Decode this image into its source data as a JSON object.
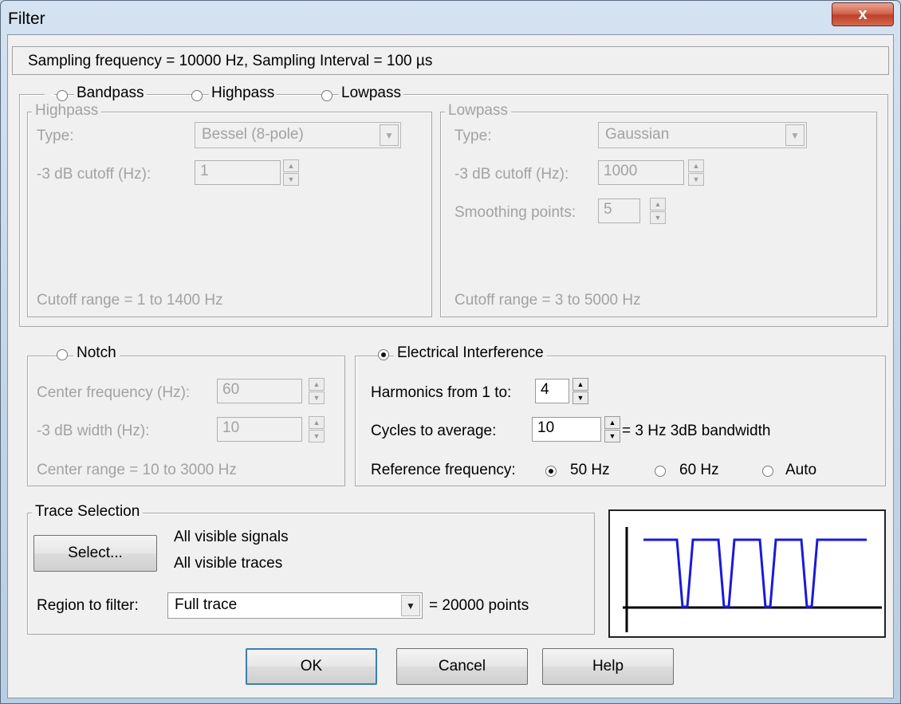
{
  "window": {
    "title": "Filter",
    "close_glyph": "x"
  },
  "info": "Sampling frequency = 10000 Hz, Sampling Interval = 100 µs",
  "filter_modes": {
    "bandpass": "Bandpass",
    "highpass": "Highpass",
    "lowpass": "Lowpass"
  },
  "highpass": {
    "legend": "Highpass",
    "type_label": "Type:",
    "type_value": "Bessel (8-pole)",
    "cutoff_label": "-3 dB cutoff (Hz):",
    "cutoff_value": "1",
    "range": "Cutoff range = 1 to 1400 Hz"
  },
  "lowpass": {
    "legend": "Lowpass",
    "type_label": "Type:",
    "type_value": "Gaussian",
    "cutoff_label": "-3 dB cutoff (Hz):",
    "cutoff_value": "1000",
    "smoothing_label": "Smoothing points:",
    "smoothing_value": "5",
    "range": "Cutoff range = 3 to 5000 Hz"
  },
  "notch": {
    "legend": "Notch",
    "center_label": "Center frequency (Hz):",
    "center_value": "60",
    "width_label": "-3 dB width (Hz):",
    "width_value": "10",
    "range": "Center range = 10 to 3000 Hz"
  },
  "electrical": {
    "legend": "Electrical Interference",
    "selected": true,
    "harmonics_label": "Harmonics from 1 to:",
    "harmonics_value": "4",
    "cycles_label": "Cycles to average:",
    "cycles_value": "10",
    "bandwidth_text": "= 3 Hz 3dB bandwidth",
    "ref_label": "Reference frequency:",
    "ref_options": [
      "50 Hz",
      "60 Hz",
      "Auto"
    ],
    "ref_selected": "50 Hz"
  },
  "trace_selection": {
    "legend": "Trace Selection",
    "select_button": "Select...",
    "signals_text": "All visible signals",
    "traces_text": "All visible traces",
    "region_label": "Region to filter:",
    "region_value": "Full trace",
    "points_text": "= 20000 points"
  },
  "buttons": {
    "ok": "OK",
    "cancel": "Cancel",
    "help": "Help"
  },
  "colors": {
    "trace": "#1a1ad8",
    "axis": "#000000"
  },
  "icons": {
    "close": "close-icon",
    "dropdown": "chevron-down-icon",
    "spin": "spin-arrows-icon"
  }
}
